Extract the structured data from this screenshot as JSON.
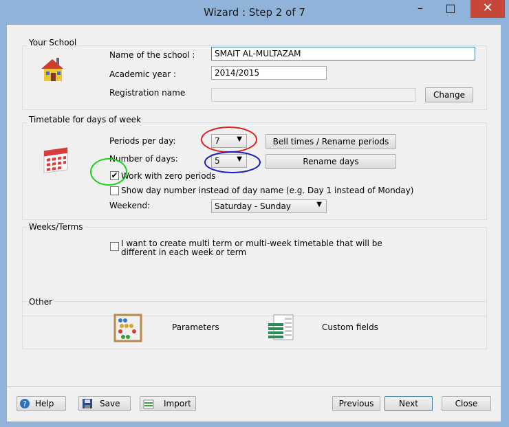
{
  "window": {
    "title": "Wizard : Step 2 of 7",
    "minimize_glyph": "–",
    "maximize_glyph": "□",
    "close_glyph": "✕"
  },
  "your_school": {
    "title": "Your School",
    "name_label": "Name of the school :",
    "name_value": "SMAIT AL-MULTAZAM",
    "year_label": "Academic year :",
    "year_value": "2014/2015",
    "registration_label": "Registration name",
    "registration_value": "",
    "change_button": "Change"
  },
  "timetable": {
    "title": "Timetable for days of week",
    "periods_label": "Periods per day:",
    "periods_value": "7",
    "bell_button": "Bell times / Rename periods",
    "days_label": "Number of days:",
    "days_value": "5",
    "rename_days_button": "Rename days",
    "zero_periods_label": "Work with zero periods",
    "zero_periods_checked": true,
    "show_day_number_label": "Show day number instead of day name (e.g. Day 1 instead of Monday)",
    "show_day_number_checked": false,
    "weekend_label": "Weekend:",
    "weekend_value": "Saturday - Sunday"
  },
  "weeks_terms": {
    "title": "Weeks/Terms",
    "multi_term_label_line1": "I want to create multi term or multi-week timetable that will be",
    "multi_term_label_line2": "different in each week or term",
    "multi_term_checked": false
  },
  "other": {
    "title": "Other",
    "parameters_label": "Parameters",
    "custom_fields_label": "Custom fields"
  },
  "footer": {
    "help": "Help",
    "save": "Save",
    "import": "Import",
    "previous": "Previous",
    "next": "Next",
    "close": "Close"
  },
  "annotations": {
    "red": "#e02020",
    "blue": "#1c1cc8",
    "green": "#19d419"
  },
  "icons": {
    "school": "school-house-icon",
    "calendar": "calendar-icon",
    "abacus": "abacus-icon",
    "table": "custom-fields-table-icon",
    "help": "help-icon",
    "save": "save-disk-icon",
    "import": "import-icon"
  }
}
